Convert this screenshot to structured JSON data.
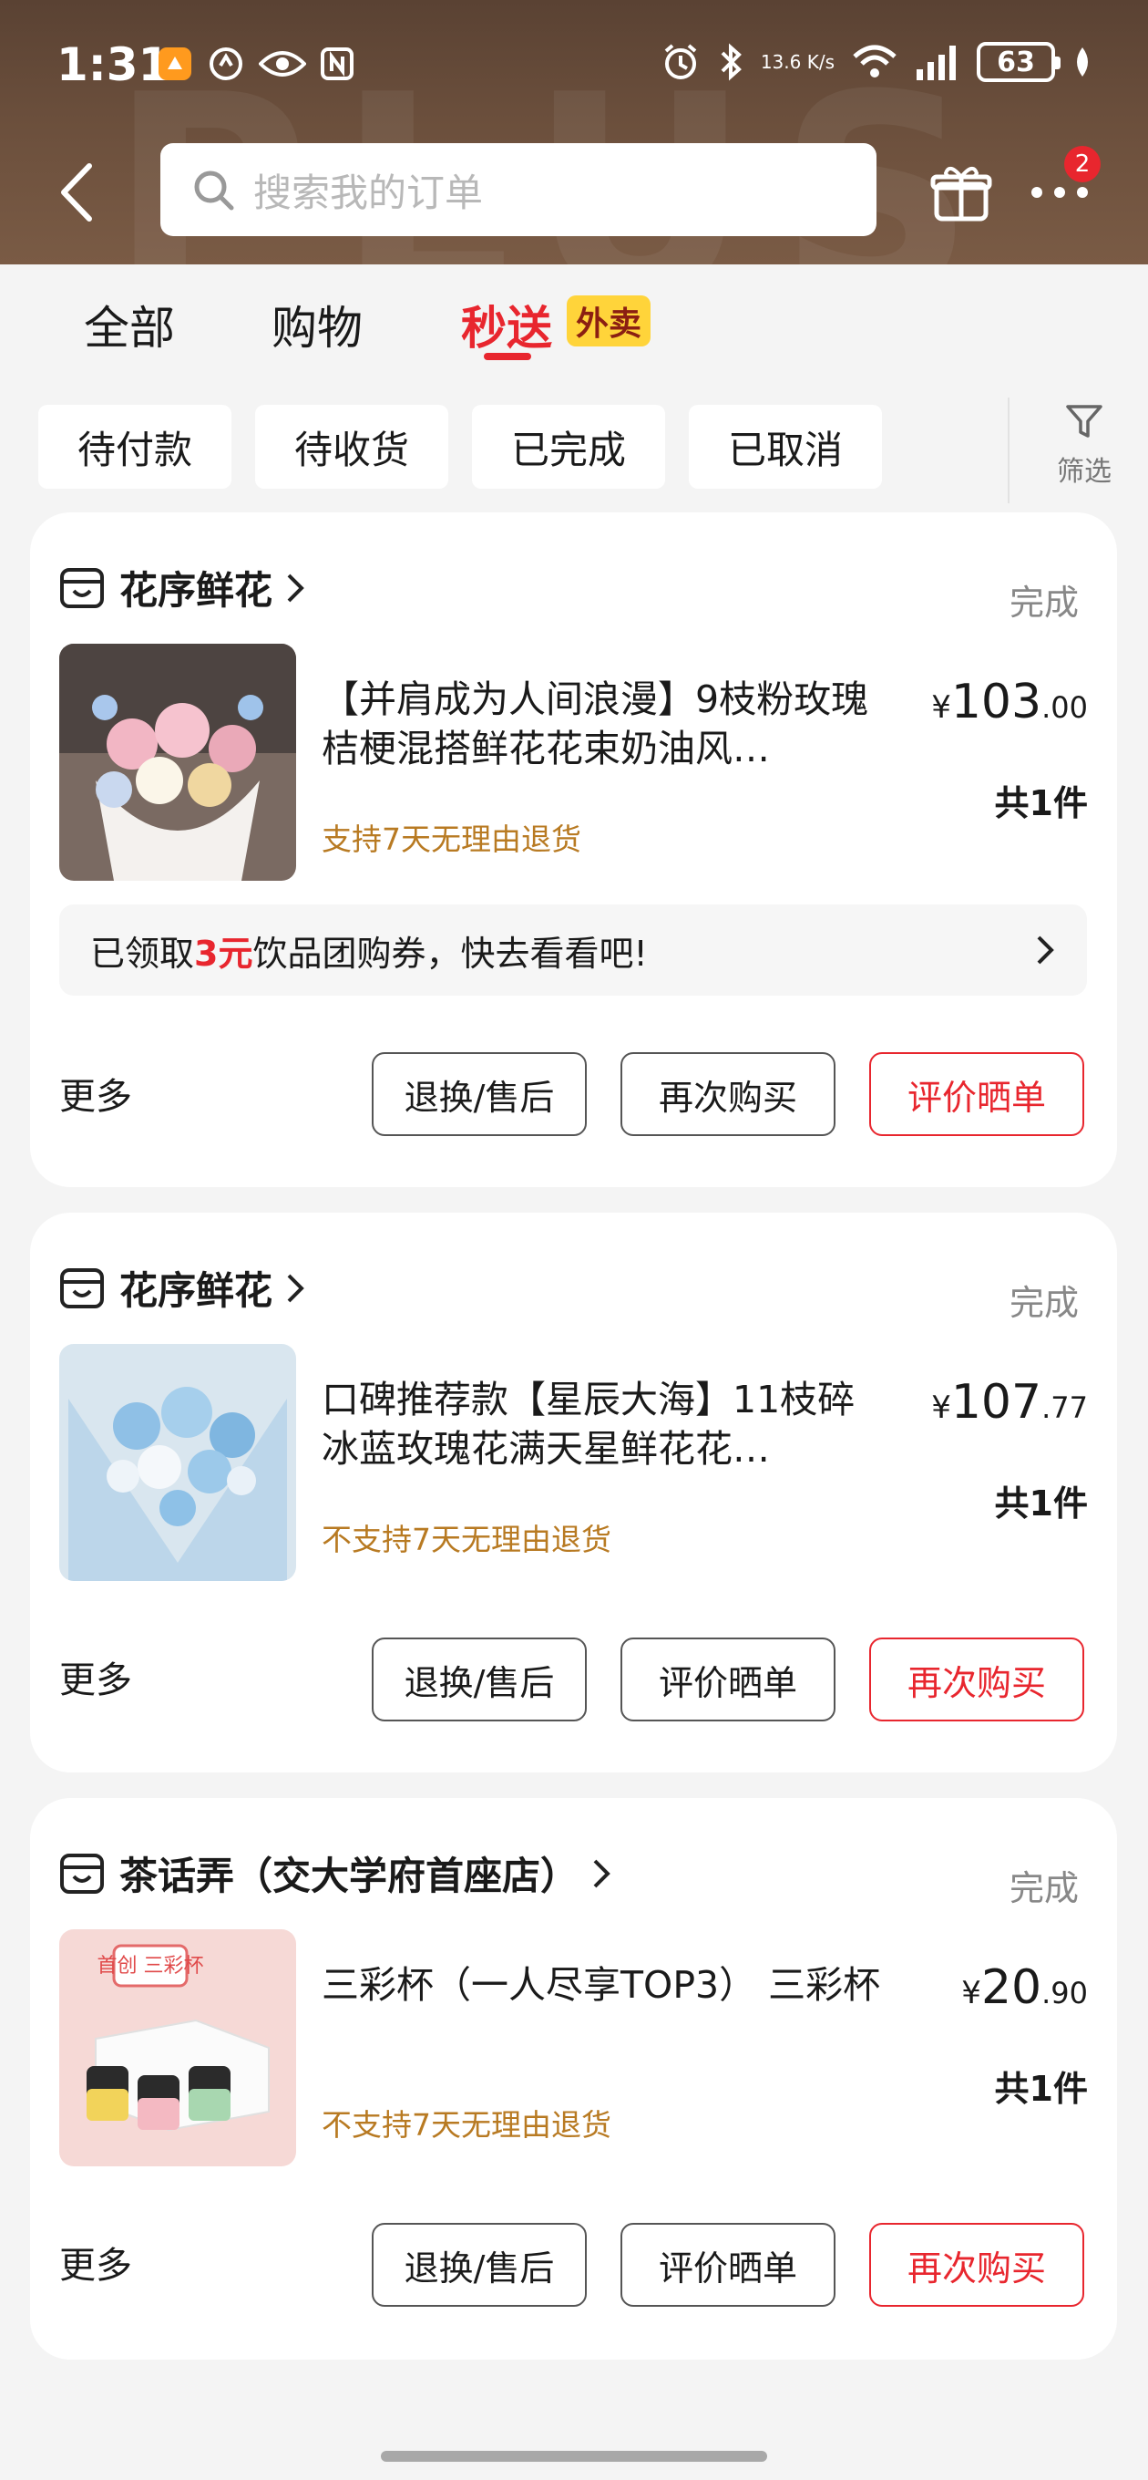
{
  "status_bar": {
    "time": "1:31",
    "netspeed": "13.6 K/s",
    "battery": "63"
  },
  "search": {
    "placeholder": "搜索我的订单"
  },
  "header": {
    "badge_count": "2"
  },
  "tabs": [
    {
      "label": "全部"
    },
    {
      "label": "购物"
    },
    {
      "label": "秒送",
      "tag": "外卖",
      "active": true
    }
  ],
  "filters": {
    "chips": [
      "待付款",
      "待收货",
      "已完成",
      "已取消"
    ],
    "filter_label": "筛选"
  },
  "orders": [
    {
      "shop": "花序鲜花",
      "status": "完成",
      "product": "【并肩成为人间浪漫】9枝粉玫瑰桔梗混搭鲜花花束奶油风…",
      "policy": "支持7天无理由退货",
      "price_int": "103",
      "price_dec": ".00",
      "currency": "¥",
      "qty": "共1件",
      "coupon_pre": "已领取",
      "coupon_amount": "3元",
      "coupon_post": "饮品团购券，快去看看吧!",
      "more": "更多",
      "buttons": [
        "退换/售后",
        "再次购买",
        "评价晒单"
      ]
    },
    {
      "shop": "花序鲜花",
      "status": "完成",
      "product": "口碑推荐款【星辰大海】11枝碎冰蓝玫瑰花满天星鲜花花…",
      "policy": "不支持7天无理由退货",
      "price_int": "107",
      "price_dec": ".77",
      "currency": "¥",
      "qty": "共1件",
      "more": "更多",
      "buttons": [
        "退换/售后",
        "评价晒单",
        "再次购买"
      ]
    },
    {
      "shop": "茶话弄（交大学府首座店）",
      "status": "完成",
      "product": "三彩杯（一人尽享TOP3） 三彩杯",
      "policy": "不支持7天无理由退货",
      "price_int": "20",
      "price_dec": ".90",
      "currency": "¥",
      "qty": "共1件",
      "more": "更多",
      "buttons": [
        "退换/售后",
        "评价晒单",
        "再次购买"
      ],
      "thumb_label": "首创 三彩杯"
    }
  ],
  "colors": {
    "accent": "#e8262e",
    "policy": "#b87a22",
    "header_bg": "#5a4233"
  }
}
